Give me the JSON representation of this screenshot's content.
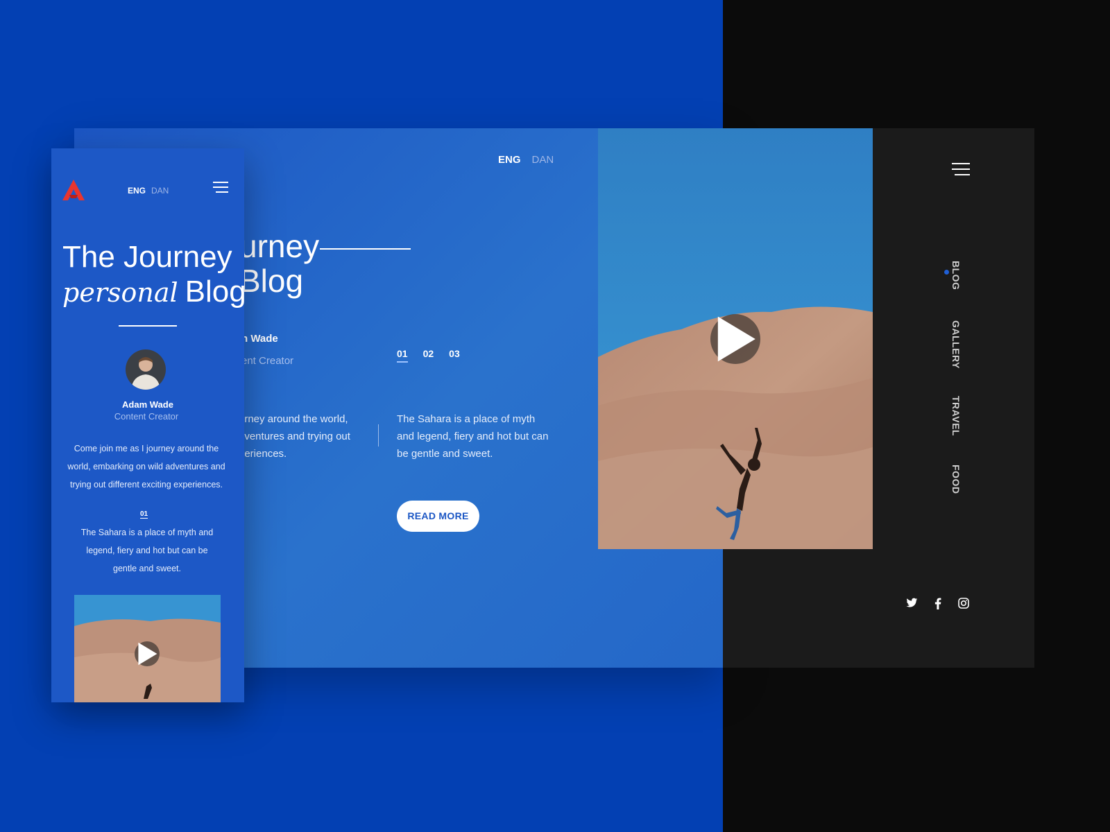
{
  "desktop": {
    "lang": {
      "active": "ENG",
      "alt": "DAN"
    },
    "title_line1": "urney",
    "title_line2": "Blog",
    "author_name": "n Wade",
    "author_role": "ent Creator",
    "pager": [
      "01",
      "02",
      "03"
    ],
    "body_left": "urney around the world, dventures and trying out periences.",
    "body_right": "The Sahara is a place of myth and legend, fiery and hot but can be gentle and sweet.",
    "read_more": "READ MORE",
    "nav": [
      "BLOG",
      "GALLERY",
      "TRAVEL",
      "FOOD"
    ],
    "social": [
      "twitter-icon",
      "facebook-icon",
      "instagram-icon"
    ]
  },
  "mobile": {
    "lang": {
      "active": "ENG",
      "alt": "DAN"
    },
    "title_line1": "The Journey",
    "title_script": "personal",
    "title_word": "Blog",
    "author_name": "Adam Wade",
    "author_role": "Content Creator",
    "body1": "Come join me as I journey around the world, embarking on wild adventures and trying out different exciting experiences.",
    "page": "01",
    "body2": "The Sahara is a place of myth and legend, fiery and hot but can be gentle and sweet."
  },
  "colors": {
    "brand_blue": "#0340b3",
    "logo_red": "#e8352e",
    "dark": "#1b1b1b"
  }
}
